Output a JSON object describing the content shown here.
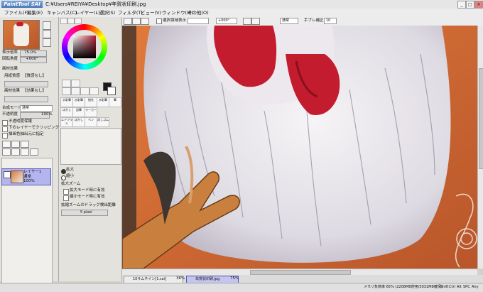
{
  "app": {
    "logo_text": "PaintTool SAI",
    "title": "C:¥Users¥REIYA¥Desktop¥年賀状印刷.jpg"
  },
  "window_controls": [
    "_",
    "□",
    "×"
  ],
  "menus": [
    "ファイル(F)",
    "編集(E)",
    "キャンバス(C)",
    "レイヤー(L)",
    "選択(S)",
    "フィルタ(T)",
    "ビュー(V)",
    "ウィンドウ(W)",
    "その他(O)"
  ],
  "navigator": {
    "zoom_label": "表示倍率",
    "zoom_value": "75.0%",
    "angle_label": "回転角度",
    "angle_value": "+000°"
  },
  "layer_panel": {
    "effect_header": "画材効果",
    "paper_label": "用紙質感",
    "paper_value": "【質感なし】",
    "effect_label": "画材効果",
    "effect_value": "【効果なし】",
    "blend_label": "合成モード",
    "blend_value": "通常",
    "opacity_label": "不透明度",
    "opacity_value": "100%",
    "checks": [
      "不透明度保護",
      "下のレイヤーでクリッピング",
      "描画色抽出元に指定"
    ],
    "layer_name": "レイヤー1",
    "layer_mode": "通常",
    "layer_opacity": "100%"
  },
  "tools": {
    "brushes_row1": [
      "水彩筆",
      "水彩筆",
      "指先",
      "水彩筆",
      "筆"
    ],
    "brushes_row2": [
      "ぼかし",
      "鉛筆",
      "マーカー"
    ],
    "brushes_row3": [
      "エアブラシ",
      "ぼかし",
      "ペン",
      "消しゴム"
    ],
    "options": [
      "拡大",
      "縮小"
    ],
    "zoom_header": "拡大ズーム",
    "zoom_checks": [
      "拡大モード時に有効",
      "縮小モード時に有効"
    ],
    "drag_label": "拡縮ズームのドラッグ検出距離",
    "drag_value": "5 pixel"
  },
  "canvas_toolbar": {
    "selection_check_label": "選択領域表示",
    "angle_value": "+000°",
    "blend_value": "通常",
    "stabilizer_label": "手ブレ補正",
    "stabilizer_value": "10"
  },
  "tabs": [
    {
      "label": "10サムネイン[1.sai]",
      "zoom": "36%"
    },
    {
      "label": "年賀状印刷.jpg",
      "zoom": "75%"
    }
  ],
  "statusbar": {
    "memory": "メモリ負荷率 65% (2208MB使用/3031MB確保)",
    "indicators": [
      "Shift",
      "Ctrl",
      "Alt",
      "SPC",
      "Any"
    ]
  },
  "colors": {
    "accent": "#5a5ab0",
    "canvas_bg": "#c9662f",
    "comb": "#c21c2e"
  }
}
